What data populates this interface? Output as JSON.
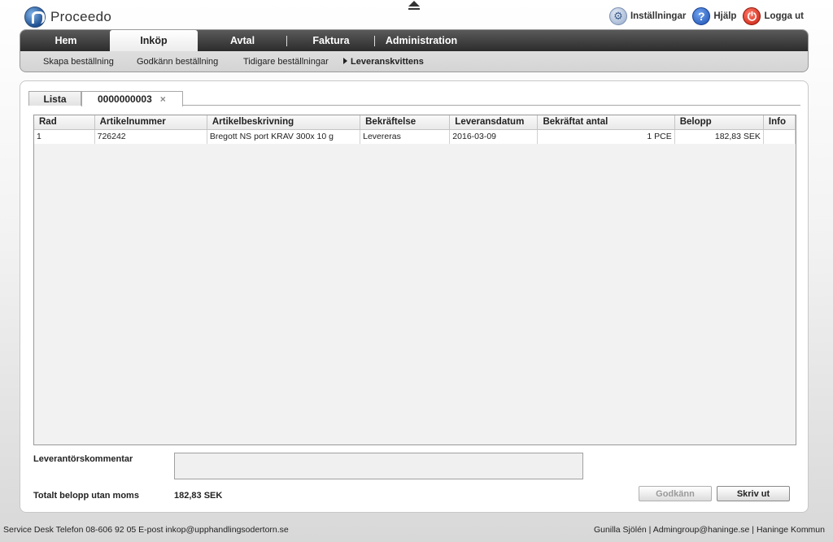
{
  "app": {
    "logo_text": "Proceedo"
  },
  "toplinks": {
    "settings": "Inställningar",
    "help": "Hjälp",
    "logout": "Logga ut"
  },
  "nav": {
    "tabs": [
      "Hem",
      "Inköp",
      "Avtal",
      "Faktura",
      "Administration"
    ],
    "active_tab": "Inköp",
    "subnav": [
      "Skapa beställning",
      "Godkänn beställning",
      "Tidigare beställningar",
      "Leveranskvittens"
    ]
  },
  "panel_tabs": {
    "list": "Lista",
    "order": "0000000003",
    "close": "×"
  },
  "table": {
    "headers": [
      "Rad",
      "Artikelnummer",
      "Artikelbeskrivning",
      "Bekräftelse",
      "Leveransdatum",
      "Bekräftat antal",
      "Belopp",
      "Info"
    ],
    "rows": [
      [
        "1",
        "726242",
        "Bregott NS port KRAV 300x 10 g",
        "Levereras",
        "2016-03-09",
        "1 PCE",
        "182,83 SEK",
        ""
      ]
    ]
  },
  "form": {
    "comment_label": "Leverantörskommentar",
    "comment_value": "",
    "total_label": "Totalt belopp utan moms",
    "total_value": "182,83  SEK"
  },
  "buttons": {
    "approve": "Godkänn",
    "print": "Skriv ut"
  },
  "footer": {
    "left": "Service Desk Telefon 08-606 92 05   E-post inkop@upphandlingsodertorn.se",
    "right": "Gunilla Sjölén | Admingroup@haninge.se | Haninge Kommun"
  }
}
